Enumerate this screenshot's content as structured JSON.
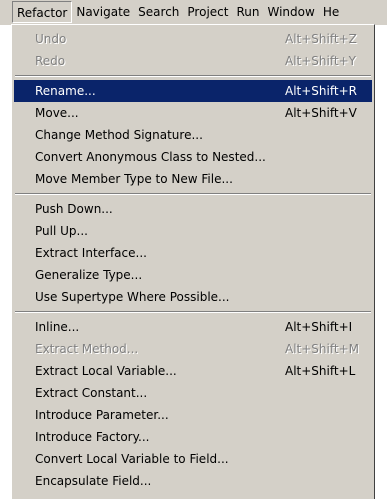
{
  "menubar": {
    "items": [
      "Refactor",
      "Navigate",
      "Search",
      "Project",
      "Run",
      "Window",
      "He"
    ]
  },
  "menu": {
    "groups": [
      [
        {
          "label": "Undo",
          "shortcut": "Alt+Shift+Z",
          "disabled": true
        },
        {
          "label": "Redo",
          "shortcut": "Alt+Shift+Y",
          "disabled": true
        }
      ],
      [
        {
          "label": "Rename...",
          "shortcut": "Alt+Shift+R",
          "selected": true
        },
        {
          "label": "Move...",
          "shortcut": "Alt+Shift+V"
        },
        {
          "label": "Change Method Signature...",
          "shortcut": ""
        },
        {
          "label": "Convert Anonymous Class to Nested...",
          "shortcut": ""
        },
        {
          "label": "Move Member Type to New File...",
          "shortcut": ""
        }
      ],
      [
        {
          "label": "Push Down...",
          "shortcut": ""
        },
        {
          "label": "Pull Up...",
          "shortcut": ""
        },
        {
          "label": "Extract Interface...",
          "shortcut": ""
        },
        {
          "label": "Generalize Type...",
          "shortcut": ""
        },
        {
          "label": "Use Supertype Where Possible...",
          "shortcut": ""
        }
      ],
      [
        {
          "label": "Inline...",
          "shortcut": "Alt+Shift+I"
        },
        {
          "label": "Extract Method...",
          "shortcut": "Alt+Shift+M",
          "disabled": true
        },
        {
          "label": "Extract Local Variable...",
          "shortcut": "Alt+Shift+L"
        },
        {
          "label": "Extract Constant...",
          "shortcut": ""
        },
        {
          "label": "Introduce Parameter...",
          "shortcut": ""
        },
        {
          "label": "Introduce Factory...",
          "shortcut": ""
        },
        {
          "label": "Convert Local Variable to Field...",
          "shortcut": ""
        },
        {
          "label": "Encapsulate Field...",
          "shortcut": ""
        }
      ]
    ]
  },
  "colors": {
    "face": "#d4d0c8",
    "selection": "#0a246a",
    "disabled_text": "#808080"
  }
}
